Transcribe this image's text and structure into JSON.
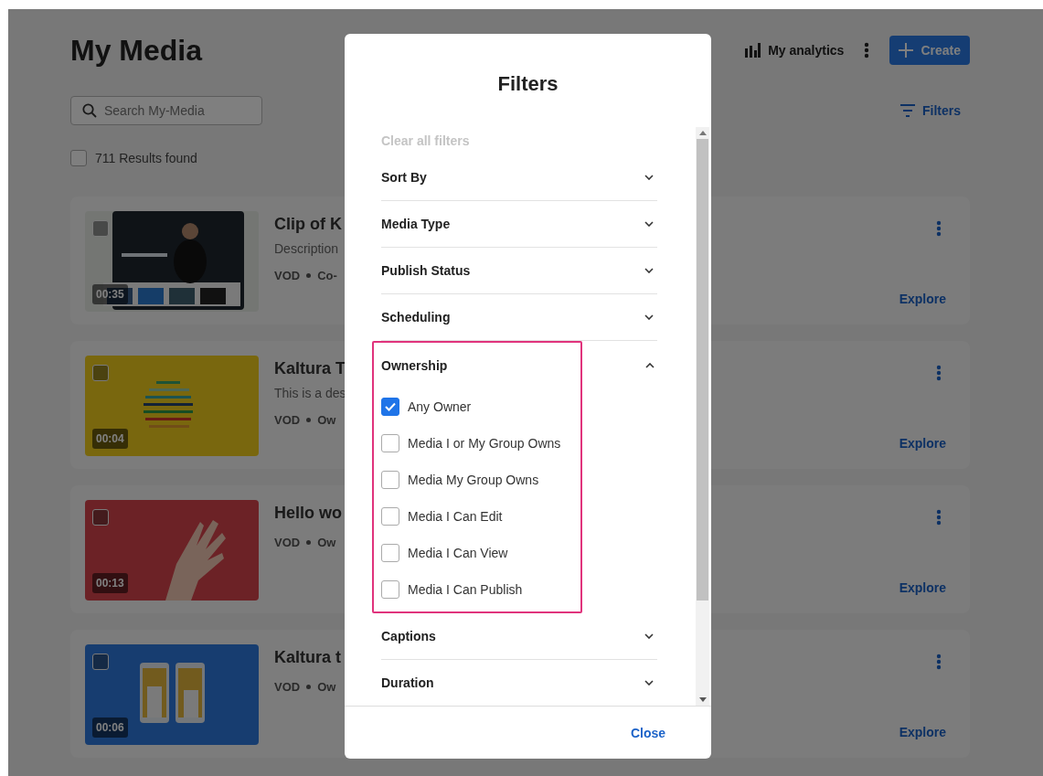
{
  "page": {
    "title": "My Media",
    "analytics": "My analytics",
    "create": "Create",
    "search": {
      "placeholder": "Search My-Media"
    },
    "filters_button": "Filters",
    "select_all": {
      "checked": false,
      "label": "711 Results found"
    }
  },
  "entries": [
    {
      "duration": "00:35",
      "title": "Clip of K",
      "description": "Description",
      "meta": [
        "VOD",
        "Co-"
      ],
      "action": "Explore",
      "checked": false
    },
    {
      "duration": "00:04",
      "title": "Kaltura T",
      "description": "This is a des",
      "meta": [
        "VOD",
        "Ow"
      ],
      "action": "Explore",
      "checked": false
    },
    {
      "duration": "00:13",
      "title": "Hello wo",
      "meta": [
        "VOD",
        "Ow"
      ],
      "action": "Explore",
      "checked": false
    },
    {
      "duration": "00:06",
      "title": "Kaltura t",
      "meta": [
        "VOD",
        "Ow"
      ],
      "action": "Explore",
      "checked": false
    }
  ],
  "dialog": {
    "title": "Filters",
    "clear_all": {
      "label": "Clear all filters",
      "disabled": true
    },
    "sections": [
      {
        "label": "Sort By",
        "expanded": false,
        "highlighted": false
      },
      {
        "label": "Media Type",
        "expanded": false,
        "highlighted": false
      },
      {
        "label": "Publish Status",
        "expanded": false,
        "highlighted": false
      },
      {
        "label": "Scheduling",
        "expanded": false,
        "highlighted": false
      },
      {
        "label": "Ownership",
        "expanded": true,
        "highlighted": true,
        "options": [
          {
            "label": "Any Owner",
            "checked": true
          },
          {
            "label": "Media I or My Group Owns",
            "checked": false
          },
          {
            "label": "Media My Group Owns",
            "checked": false
          },
          {
            "label": "Media I Can Edit",
            "checked": false
          },
          {
            "label": "Media I Can View",
            "checked": false
          },
          {
            "label": "Media I Can Publish",
            "checked": false
          }
        ]
      },
      {
        "label": "Captions",
        "expanded": false,
        "highlighted": false
      },
      {
        "label": "Duration",
        "expanded": false,
        "highlighted": false
      }
    ],
    "close": "Close"
  }
}
